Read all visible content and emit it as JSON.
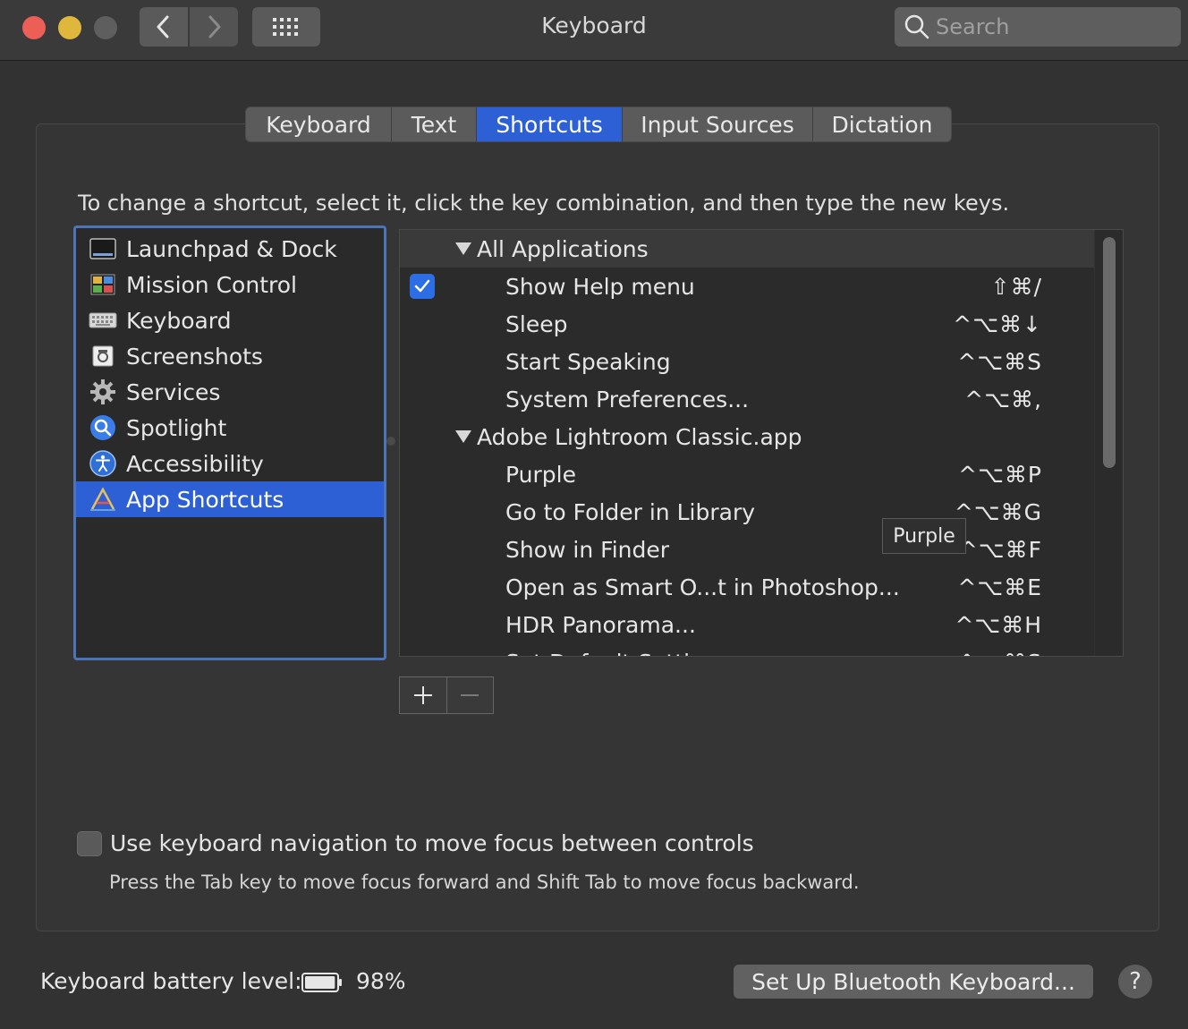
{
  "window": {
    "title": "Keyboard"
  },
  "search": {
    "placeholder": "Search"
  },
  "tabs": [
    {
      "label": "Keyboard"
    },
    {
      "label": "Text"
    },
    {
      "label": "Shortcuts"
    },
    {
      "label": "Input Sources"
    },
    {
      "label": "Dictation"
    }
  ],
  "active_tab": "Shortcuts",
  "instructions": "To change a shortcut, select it, click the key combination, and then type the new keys.",
  "categories": [
    {
      "label": "Launchpad & Dock",
      "icon": "launchpad-icon"
    },
    {
      "label": "Mission Control",
      "icon": "mission-control-icon"
    },
    {
      "label": "Keyboard",
      "icon": "keyboard-icon"
    },
    {
      "label": "Screenshots",
      "icon": "screenshot-icon"
    },
    {
      "label": "Services",
      "icon": "gear-icon"
    },
    {
      "label": "Spotlight",
      "icon": "spotlight-icon"
    },
    {
      "label": "Accessibility",
      "icon": "accessibility-icon"
    },
    {
      "label": "App Shortcuts",
      "icon": "app-store-icon"
    }
  ],
  "selected_category": "App Shortcuts",
  "shortcuts": {
    "group_all": "All Applications",
    "all_items": [
      {
        "label": "Show Help menu",
        "keys": "⇧⌘/",
        "checked": true
      },
      {
        "label": "Sleep",
        "keys": "^⌥⌘↓"
      },
      {
        "label": "Start Speaking",
        "keys": "^⌥⌘S"
      },
      {
        "label": "System Preferences...",
        "keys": "^⌥⌘,"
      }
    ],
    "group_lightroom": "Adobe Lightroom Classic.app",
    "lightroom_items": [
      {
        "label": "Purple",
        "keys": "^⌥⌘P"
      },
      {
        "label": "Go to Folder in Library",
        "keys": "^⌥⌘G"
      },
      {
        "label": "Show in Finder",
        "keys": "^⌥⌘F"
      },
      {
        "label": "Open as Smart O...t in Photoshop...",
        "keys": "^⌥⌘E"
      },
      {
        "label": "HDR Panorama...",
        "keys": "^⌥⌘H"
      },
      {
        "label": "Set Default Setti...",
        "keys": "^⌥⌘S"
      }
    ]
  },
  "tooltip": "Purple",
  "keyboard_navigation": {
    "label": "Use keyboard navigation to move focus between controls",
    "help": "Press the Tab key to move focus forward and Shift Tab to move focus backward.",
    "checked": false
  },
  "battery": {
    "label": "Keyboard battery level:",
    "percent": "98%",
    "level": 0.98
  },
  "buttons": {
    "bluetooth": "Set Up Bluetooth Keyboard...",
    "help": "?"
  },
  "colors": {
    "accent": "#2d5fd5",
    "close": "#ec5f57",
    "minimize": "#e0b73d"
  }
}
